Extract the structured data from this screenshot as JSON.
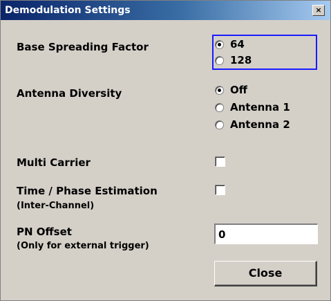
{
  "window": {
    "title": "Demodulation Settings",
    "close_glyph": "×",
    "close_icon": "close-icon"
  },
  "base_spreading_factor": {
    "label": "Base Spreading Factor",
    "options": [
      "64",
      "128"
    ],
    "selected": "64"
  },
  "antenna_diversity": {
    "label": "Antenna Diversity",
    "options": [
      "Off",
      "Antenna 1",
      "Antenna 2"
    ],
    "selected": "Off"
  },
  "multi_carrier": {
    "label": "Multi Carrier",
    "checked": false
  },
  "time_phase_estimation": {
    "label": "Time / Phase Estimation",
    "sublabel": "(Inter-Channel)",
    "checked": false
  },
  "pn_offset": {
    "label": "PN Offset",
    "sublabel": "(Only for external trigger)",
    "value": "0"
  },
  "close_button": {
    "label": "Close"
  },
  "colors": {
    "dialog_background": "#d4d0c8",
    "titlebar_start": "#0a246a",
    "titlebar_end": "#a6caf0",
    "focus_frame": "#1a1aff"
  }
}
